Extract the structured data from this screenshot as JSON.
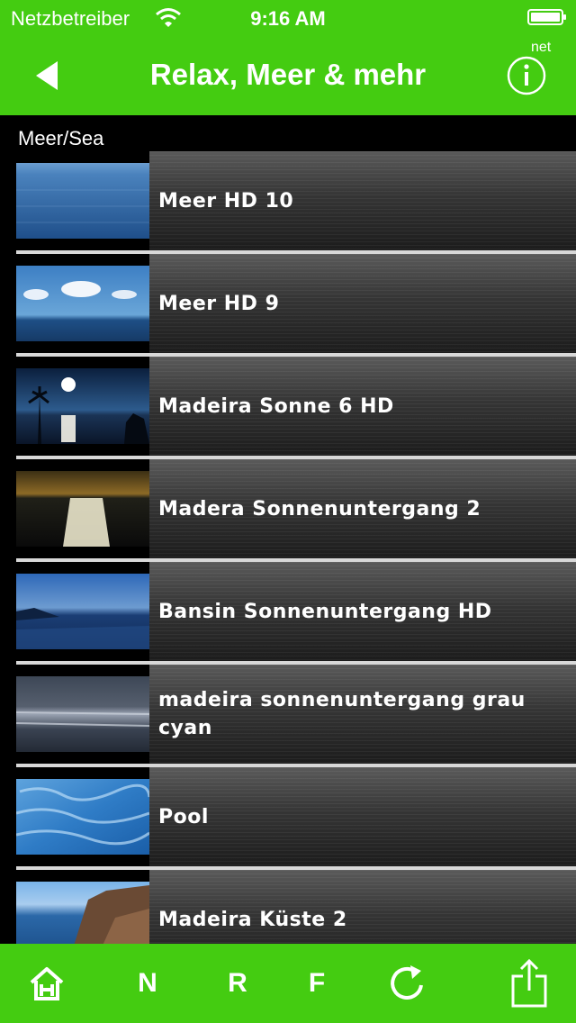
{
  "status_bar": {
    "carrier": "Netzbetreiber",
    "time": "9:16 AM"
  },
  "nav": {
    "title": "Relax, Meer & mehr",
    "net_label": "net",
    "back_icon": "back-arrow-icon",
    "info_icon": "info-icon"
  },
  "section_header": "Meer/Sea",
  "items": [
    {
      "title": "Meer HD 10"
    },
    {
      "title": "Meer HD 9"
    },
    {
      "title": "Madeira Sonne 6 HD"
    },
    {
      "title": "Madera Sonnenuntergang 2"
    },
    {
      "title": "Bansin Sonnenuntergang HD"
    },
    {
      "title": "madeira sonnenuntergang grau cyan"
    },
    {
      "title": "Pool"
    },
    {
      "title": "Madeira Küste 2"
    }
  ],
  "tabbar": {
    "home_icon": "home-icon",
    "tab_n": "N",
    "tab_r": "R",
    "tab_f": "F",
    "refresh_icon": "refresh-icon",
    "share_icon": "share-icon"
  },
  "colors": {
    "accent": "#44CC11",
    "background": "#000000",
    "separator": "#d8d8d8"
  }
}
